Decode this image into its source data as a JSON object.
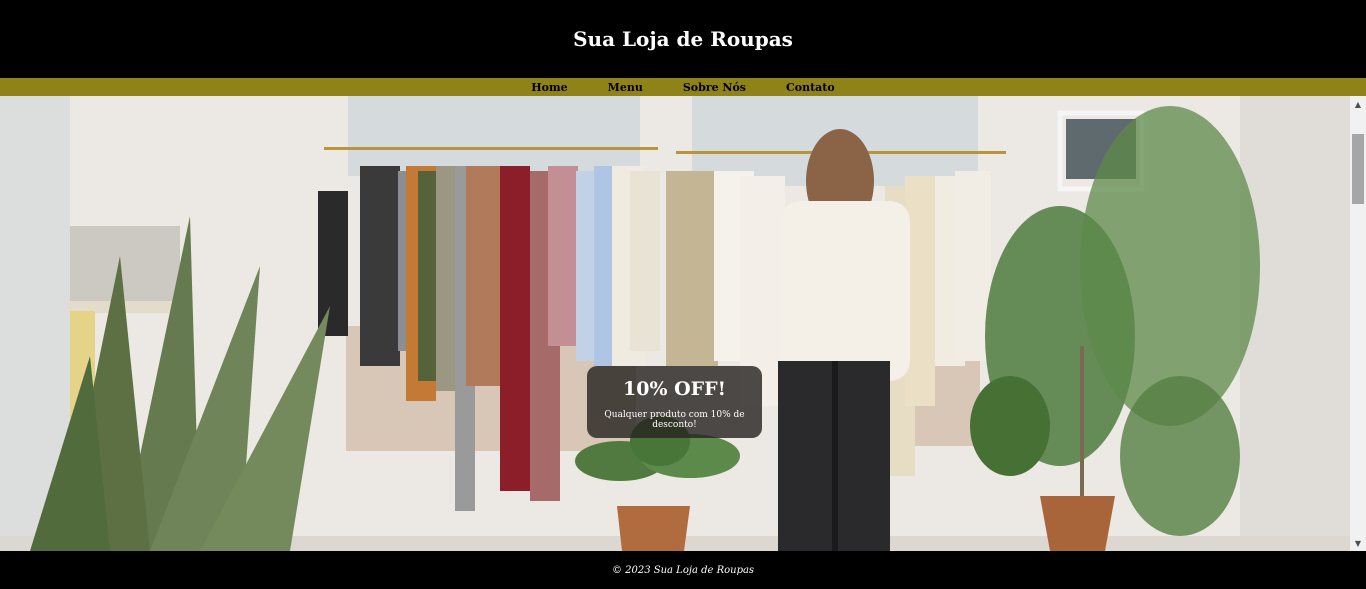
{
  "header": {
    "title": "Sua Loja de Roupas"
  },
  "nav": {
    "items": [
      "Home",
      "Menu",
      "Sobre Nós",
      "Contato"
    ]
  },
  "hero": {
    "image_icon": "clothing-store-photo",
    "promo_title": "10% OFF!",
    "promo_text": "Qualquer produto com 10% de desconto!"
  },
  "footer": {
    "copyright": "© 2023 Sua Loja de Roupas"
  },
  "colors": {
    "header_bg": "#000000",
    "nav_bg": "#8f8218",
    "footer_bg": "#000000",
    "promo_bg": "#282422"
  },
  "scrollbar": {
    "up_icon": "scroll-up-arrow-icon",
    "down_icon": "scroll-down-arrow-icon"
  }
}
